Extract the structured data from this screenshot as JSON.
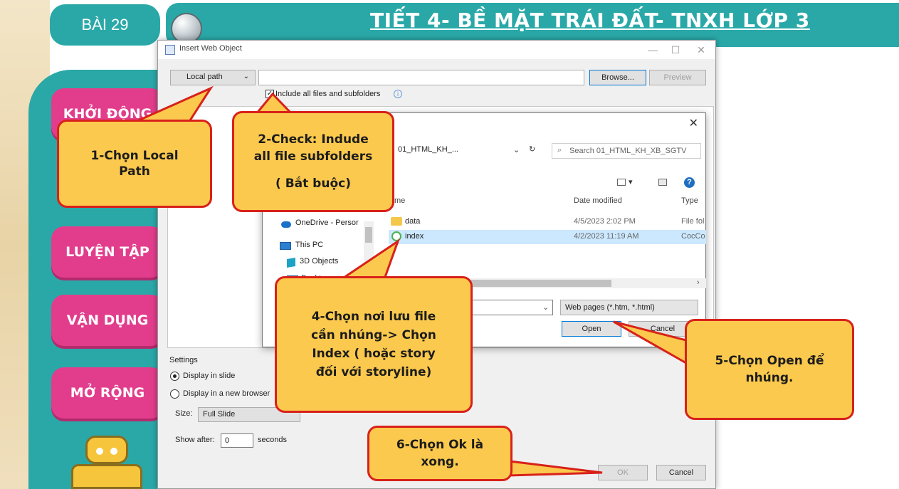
{
  "slide": {
    "lesson_label": "BÀI 29",
    "title": "TIẾT 4- BỀ MẶT TRÁI ĐẤT- TNXH LỚP 3",
    "menu": [
      "KHỞI ĐỘNG",
      "LUYỆN TẬP",
      "VẬN DỤNG",
      "MỞ RỘNG"
    ],
    "accent_teal": "#2aa8a8",
    "menu_pink": "#e23d8c"
  },
  "dialog": {
    "title": "Insert Web Object",
    "source_select": "Local path",
    "browse_label": "Browse...",
    "preview_label": "Preview",
    "include_label": "Include all files and subfolders",
    "settings_label": "Settings",
    "radio_slide": "Display in slide",
    "radio_browser": "Display in a new browser",
    "size_label": "Size:",
    "size_value": "Full Slide",
    "show_after_label": "Show after:",
    "show_after_value": "0",
    "seconds_label": "seconds",
    "ok_label": "OK",
    "cancel_label": "Cancel"
  },
  "open_dialog": {
    "breadcrumb": "01_HTML_KH_...",
    "search_placeholder": "Search 01_HTML_KH_XB_SGTV",
    "col_name": "me",
    "col_date": "Date modified",
    "col_type": "Type",
    "files": [
      {
        "name": "data",
        "date": "4/5/2023 2:02 PM",
        "type": "File fol",
        "icon": "folder-icon"
      },
      {
        "name": "index",
        "date": "4/2/2023 11:19 AM",
        "type": "CocCo",
        "icon": "html-file-icon"
      }
    ],
    "nav": [
      "OneDrive - Persor",
      "This PC",
      "3D Objects",
      "Desktop"
    ],
    "filter": "Web pages (*.htm, *.html)",
    "open_label": "Open",
    "cancel_label": "Cancel"
  },
  "callouts": {
    "c1": [
      "1-Chọn Local",
      "Path"
    ],
    "c2": [
      "2-Check: Indude",
      "all file subfolders",
      "( Bắt buộc)"
    ],
    "c4": [
      "4-Chọn nơi lưu file",
      "cần nhúng-> Chọn",
      "Index ( hoặc story",
      "đối với storyline)"
    ],
    "c5": [
      "5-Chọn Open để",
      "nhúng."
    ],
    "c6": [
      "6-Chọn Ok là",
      "xong."
    ],
    "fill_color": "#fbc94d",
    "border_color": "#d8211a"
  }
}
